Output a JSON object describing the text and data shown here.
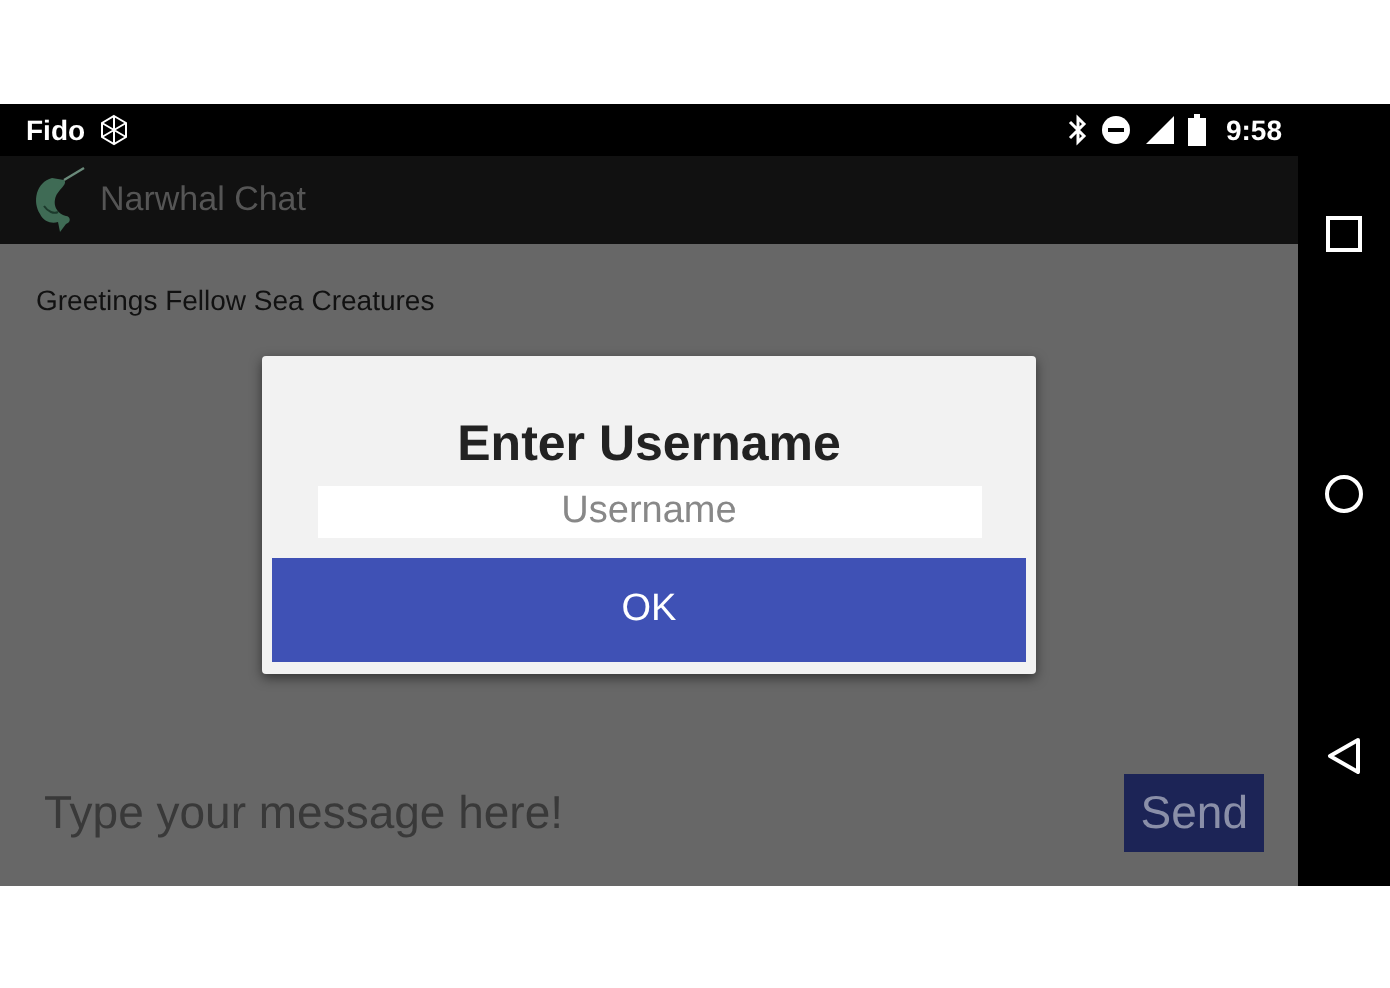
{
  "status_bar": {
    "carrier": "Fido",
    "time": "9:58"
  },
  "app_bar": {
    "title": "Narwhal Chat"
  },
  "messages": [
    "Greetings Fellow Sea Creatures"
  ],
  "composer": {
    "placeholder": "Type your message here!",
    "send": "Send"
  },
  "dialog": {
    "title": "Enter Username",
    "field": {
      "placeholder": "Username"
    },
    "button": "OK"
  }
}
